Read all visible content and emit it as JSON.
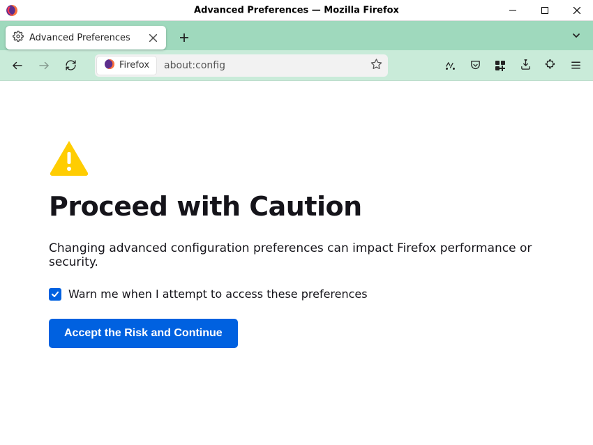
{
  "window": {
    "title": "Advanced Preferences — Mozilla Firefox"
  },
  "tab": {
    "title": "Advanced Preferences"
  },
  "urlbar": {
    "identity_label": "Firefox",
    "url": "about:config"
  },
  "page": {
    "heading": "Proceed with Caution",
    "description": "Changing advanced configuration preferences can impact Firefox performance or security.",
    "checkbox_label": "Warn me when I attempt to access these preferences",
    "checkbox_checked": true,
    "accept_button": "Accept the Risk and Continue"
  },
  "colors": {
    "accent": "#0061e0",
    "tabstrip": "#9fd9bd",
    "toolbar": "#c9ebd9",
    "warn": "#ffcd02"
  }
}
